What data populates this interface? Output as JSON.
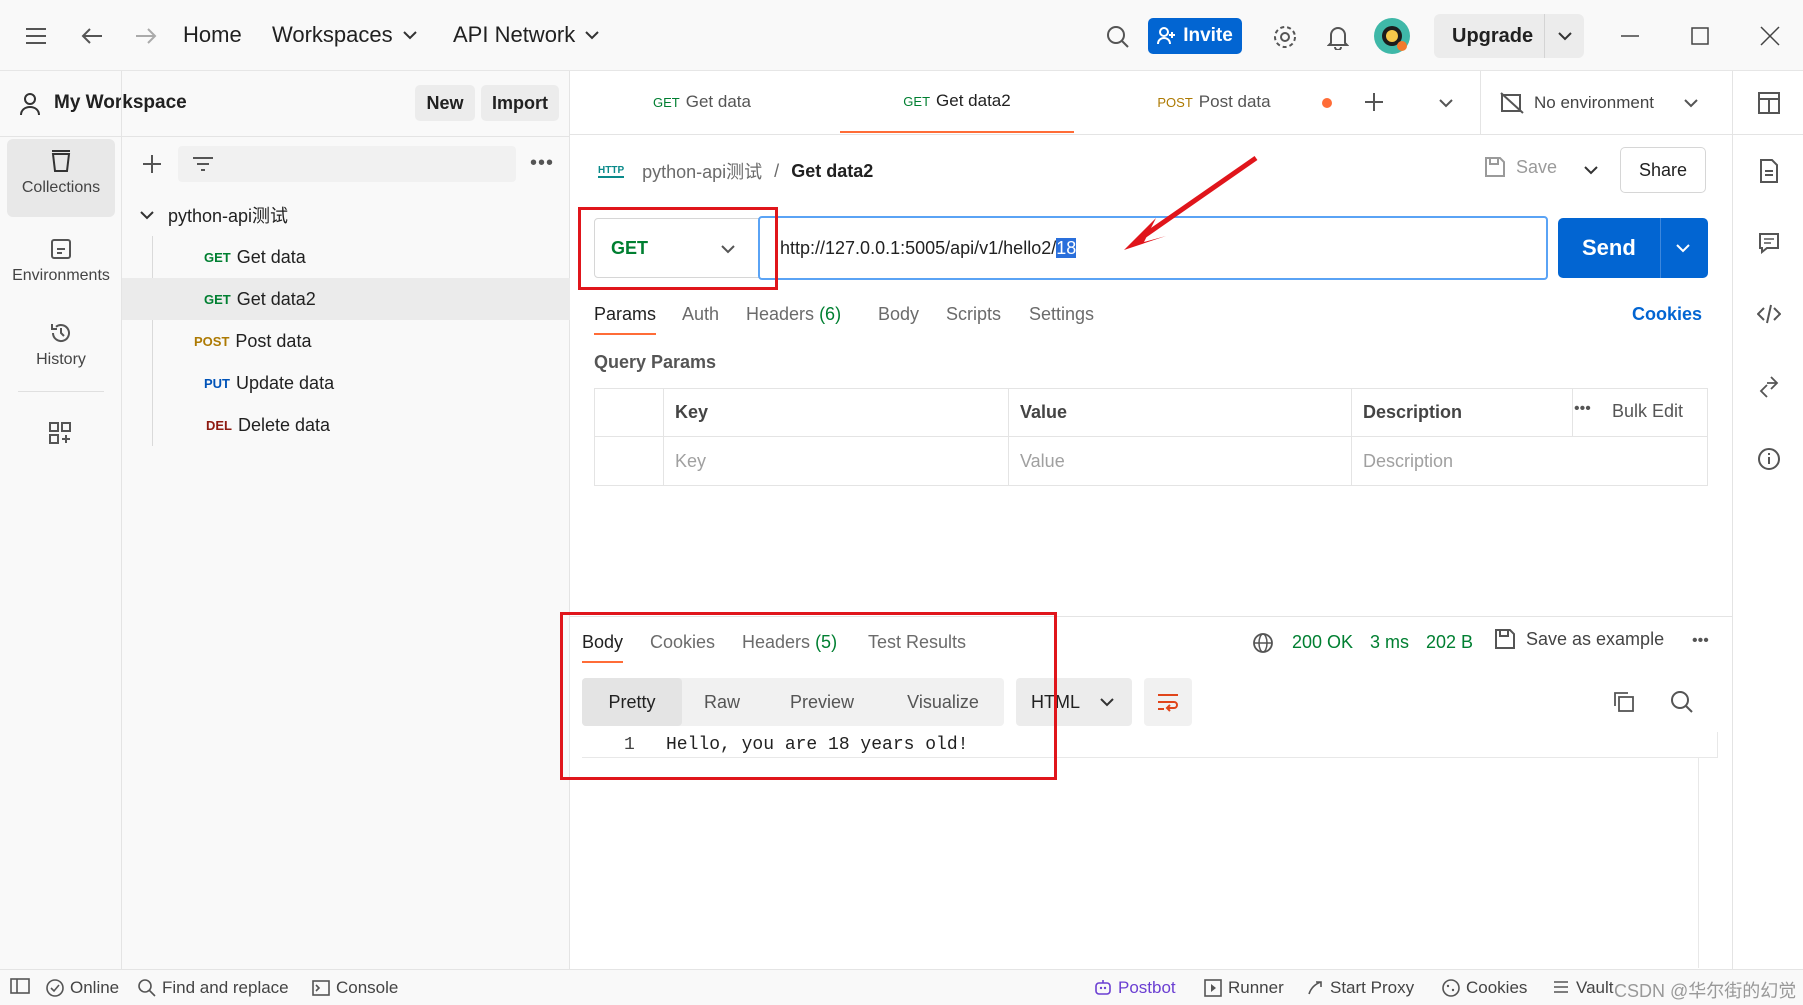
{
  "topbar": {
    "home": "Home",
    "workspaces": "Workspaces",
    "api_network": "API Network",
    "invite": "Invite",
    "upgrade": "Upgrade"
  },
  "workspace": {
    "name": "My Workspace",
    "new": "New",
    "import": "Import"
  },
  "rail": {
    "collections": "Collections",
    "environments": "Environments",
    "history": "History"
  },
  "tree": {
    "collection": "python-api测试",
    "items": [
      {
        "method": "GET",
        "name": "Get data"
      },
      {
        "method": "GET",
        "name": "Get data2"
      },
      {
        "method": "POST",
        "name": "Post data"
      },
      {
        "method": "PUT",
        "name": "Update data"
      },
      {
        "method": "DEL",
        "name": "Delete data"
      }
    ]
  },
  "tabs": [
    {
      "method": "GET",
      "name": "Get data"
    },
    {
      "method": "GET",
      "name": "Get data2"
    },
    {
      "method": "POST",
      "name": "Post data"
    }
  ],
  "environment": "No environment",
  "breadcrumb": {
    "collection": "python-api测试",
    "separator": "/",
    "request": "Get data2",
    "badge": "HTTP"
  },
  "actions": {
    "save": "Save",
    "share": "Share"
  },
  "request": {
    "method": "GET",
    "url_prefix": "http://127.0.0.1:5005/api/v1/hello2/",
    "url_selected": "18",
    "send": "Send"
  },
  "request_tabs": {
    "params": "Params",
    "auth": "Auth",
    "headers": "Headers",
    "headers_count": "(6)",
    "body": "Body",
    "scripts": "Scripts",
    "settings": "Settings",
    "cookies": "Cookies"
  },
  "query_params": {
    "title": "Query Params",
    "headers": {
      "key": "Key",
      "value": "Value",
      "description": "Description",
      "bulk_edit": "Bulk Edit"
    },
    "placeholders": {
      "key": "Key",
      "value": "Value",
      "description": "Description"
    }
  },
  "response": {
    "tabs": {
      "body": "Body",
      "cookies": "Cookies",
      "headers": "Headers",
      "headers_count": "(5)",
      "test_results": "Test Results"
    },
    "status": "200 OK",
    "time": "3 ms",
    "size": "202 B",
    "save_example": "Save as example",
    "views": {
      "pretty": "Pretty",
      "raw": "Raw",
      "preview": "Preview",
      "visualize": "Visualize"
    },
    "format": "HTML",
    "line_number": "1",
    "line_text": "Hello, you are 18 years old!"
  },
  "statusbar": {
    "online": "Online",
    "find_replace": "Find and replace",
    "console": "Console",
    "postbot": "Postbot",
    "runner": "Runner",
    "start_proxy": "Start Proxy",
    "cookies": "Cookies",
    "vault": "Vault",
    "watermark": "CSDN @华尔街的幻觉"
  },
  "colors": {
    "accent": "#0265d2",
    "tab_indicator": "#ff6c37",
    "annotation_red": "#e0151b",
    "status_green": "#007f31"
  }
}
